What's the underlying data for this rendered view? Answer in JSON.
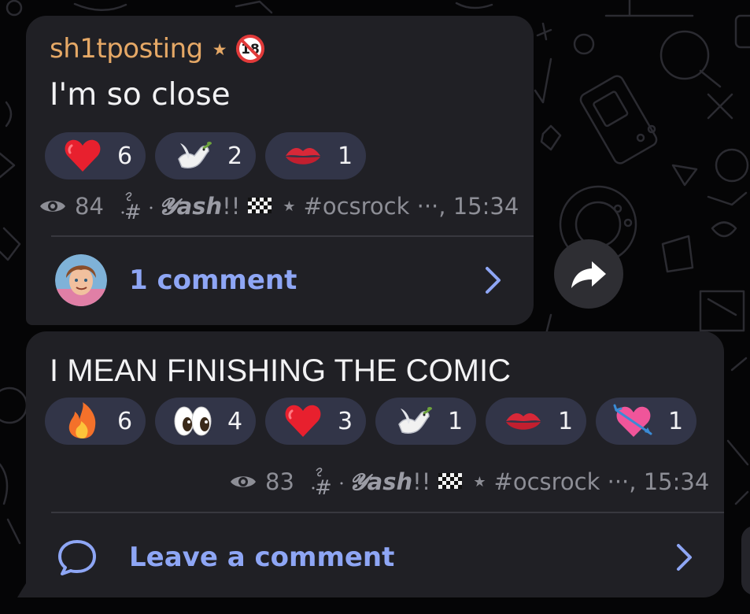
{
  "colors": {
    "background": "#050506",
    "bubble": "#202025",
    "reaction_chip": "#323548",
    "sender_name": "#e5a866",
    "link": "#8ea6f5",
    "meta_text": "#8d8e96"
  },
  "messages": [
    {
      "sender": "sh1tposting",
      "sender_badges": [
        "star-icon",
        "adult-18-icon"
      ],
      "text": "I'm so close",
      "reactions": [
        {
          "emoji": "red-heart",
          "count": "6"
        },
        {
          "emoji": "dove",
          "count": "2"
        },
        {
          "emoji": "kiss-mark",
          "count": "1"
        }
      ],
      "views": "84",
      "signature_name": "𝓨ash",
      "signature_suffix": "!!",
      "tag": "#ocsrock ···, 15:34",
      "comments_label": "1 comment",
      "comments_icon": "commenter-avatar"
    },
    {
      "text": "I MEAN FINISHING THE COMIC",
      "reactions": [
        {
          "emoji": "fire",
          "count": "6"
        },
        {
          "emoji": "eyes",
          "count": "4"
        },
        {
          "emoji": "red-heart",
          "count": "3"
        },
        {
          "emoji": "dove",
          "count": "1"
        },
        {
          "emoji": "kiss-mark",
          "count": "1"
        },
        {
          "emoji": "heart-with-arrow",
          "count": "1"
        }
      ],
      "views": "83",
      "signature_name": "𝓨ash",
      "signature_suffix": "!!",
      "tag": "#ocsrock ···, 15:34",
      "comments_label": "Leave a comment",
      "comments_icon": "comment-bubble-icon"
    }
  ],
  "share_icon": "share-arrow-icon"
}
